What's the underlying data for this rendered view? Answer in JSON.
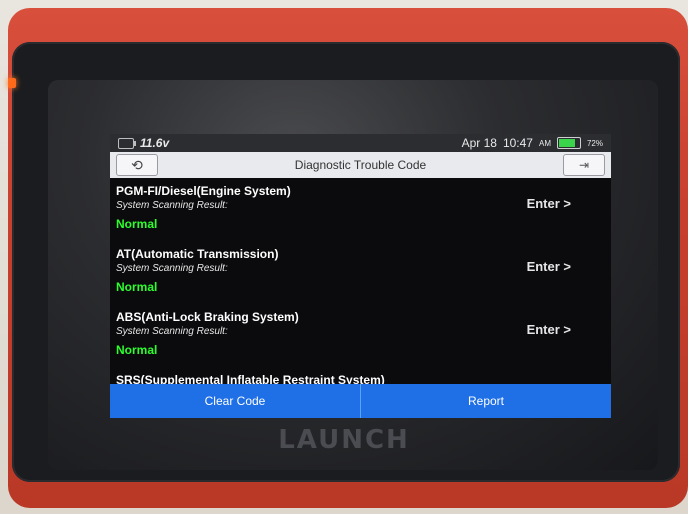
{
  "device": {
    "brand": "LAUNCH"
  },
  "status_bar": {
    "voltage": "11.6v",
    "date": "Apr 18",
    "time": "10:47",
    "ampm": "AM",
    "battery_percent": "72%"
  },
  "title_bar": {
    "title": "Diagnostic Trouble Code",
    "back_icon": "back-arrow-icon",
    "exit_icon": "exit-icon"
  },
  "systems": [
    {
      "name": "PGM-FI/Diesel(Engine System)",
      "sub": "System Scanning Result:",
      "status": "Normal",
      "enter_label": "Enter >"
    },
    {
      "name": "AT(Automatic Transmission)",
      "sub": "System Scanning Result:",
      "status": "Normal",
      "enter_label": "Enter >"
    },
    {
      "name": "ABS(Anti-Lock Braking System)",
      "sub": "System Scanning Result:",
      "status": "Normal",
      "enter_label": "Enter >"
    }
  ],
  "partial_item": {
    "name": "SRS(Supplemental Inflatable Restraint System)"
  },
  "actions": {
    "clear_code": "Clear Code",
    "report": "Report"
  },
  "colors": {
    "device_red": "#c8402e",
    "status_normal": "#2bff2b",
    "action_blue": "#1f6fe6"
  }
}
